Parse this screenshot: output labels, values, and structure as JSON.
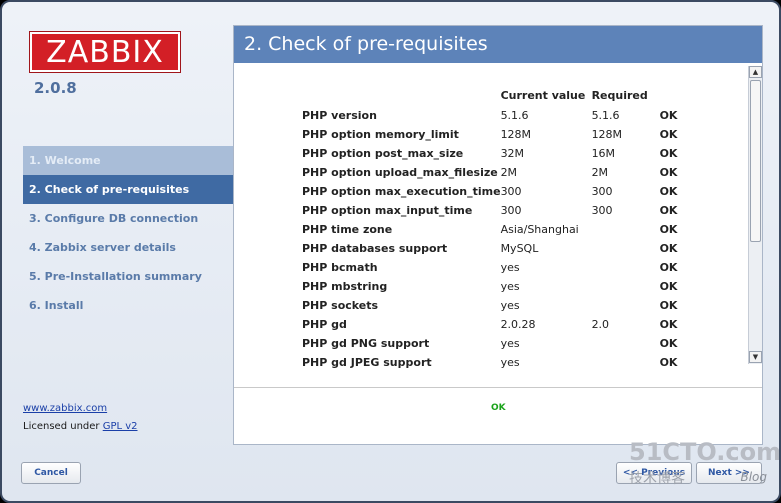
{
  "logo": {
    "text": "ZABBIX"
  },
  "version": "2.0.8",
  "steps": [
    {
      "label": "1. Welcome"
    },
    {
      "label": "2. Check of pre-requisites"
    },
    {
      "label": "3. Configure DB connection"
    },
    {
      "label": "4. Zabbix server details"
    },
    {
      "label": "5. Pre-Installation summary"
    },
    {
      "label": "6. Install"
    }
  ],
  "footer": {
    "site_link": "www.zabbix.com",
    "licensed_prefix": "Licensed under",
    "license_link": "GPL v2"
  },
  "panel": {
    "title": "2. Check of pre-requisites",
    "columns": {
      "current": "Current value",
      "required": "Required"
    },
    "rows": [
      {
        "name": "PHP version",
        "current": "5.1.6",
        "required": "5.1.6",
        "status": "OK"
      },
      {
        "name": "PHP option memory_limit",
        "current": "128M",
        "required": "128M",
        "status": "OK"
      },
      {
        "name": "PHP option post_max_size",
        "current": "32M",
        "required": "16M",
        "status": "OK"
      },
      {
        "name": "PHP option upload_max_filesize",
        "current": "2M",
        "required": "2M",
        "status": "OK"
      },
      {
        "name": "PHP option max_execution_time",
        "current": "300",
        "required": "300",
        "status": "OK"
      },
      {
        "name": "PHP option max_input_time",
        "current": "300",
        "required": "300",
        "status": "OK"
      },
      {
        "name": "PHP time zone",
        "current": "Asia/Shanghai",
        "required": "",
        "status": "OK"
      },
      {
        "name": "PHP databases support",
        "current": "MySQL",
        "required": "",
        "status": "OK"
      },
      {
        "name": "PHP bcmath",
        "current": "yes",
        "required": "",
        "status": "OK"
      },
      {
        "name": "PHP mbstring",
        "current": "yes",
        "required": "",
        "status": "OK"
      },
      {
        "name": "PHP sockets",
        "current": "yes",
        "required": "",
        "status": "OK"
      },
      {
        "name": "PHP gd",
        "current": "2.0.28",
        "required": "2.0",
        "status": "OK"
      },
      {
        "name": "PHP gd PNG support",
        "current": "yes",
        "required": "",
        "status": "OK"
      },
      {
        "name": "PHP gd JPEG support",
        "current": "yes",
        "required": "",
        "status": "OK"
      }
    ],
    "overall_status": "OK"
  },
  "buttons": {
    "cancel": "Cancel",
    "previous": "<< Previous",
    "next": "Next >>"
  },
  "watermark": {
    "line1": "51CTO.com",
    "line2": "技术博客",
    "line3": "Blog"
  },
  "colors": {
    "header": "#5d83b9",
    "active_step": "#3f6aa3",
    "ok": "#1aa31a",
    "logo": "#d31f26"
  }
}
